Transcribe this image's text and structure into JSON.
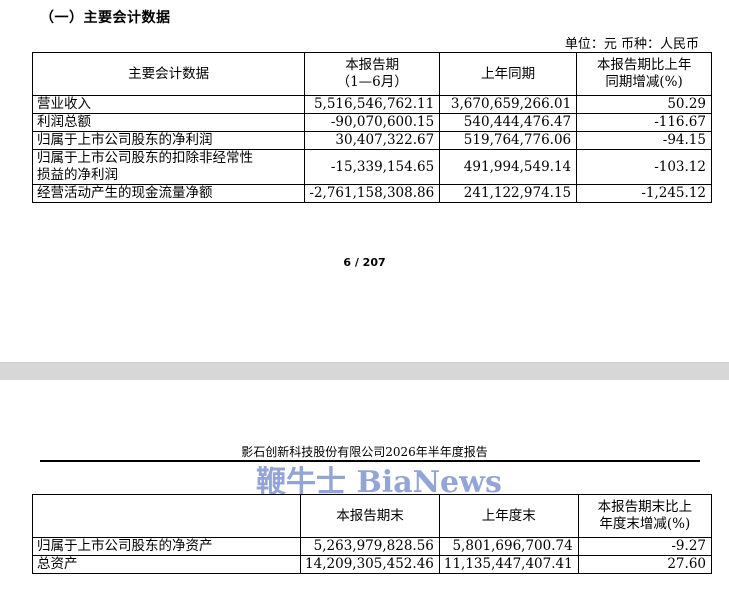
{
  "section_title": "（一）主要会计数据",
  "unit_line": "单位：元  币种：人民币",
  "table1": {
    "headers": [
      "主要会计数据",
      "本报告期",
      "（1—6月）",
      "上年同期",
      "本报告期比上年",
      "同期增减(%)"
    ],
    "rows": [
      {
        "label": "营业收入",
        "current": "5,516,546,762.11",
        "prior": "3,670,659,266.01",
        "change": "50.29"
      },
      {
        "label": "利润总额",
        "current": "-90,070,600.15",
        "prior": "540,444,476.47",
        "change": "-116.67"
      },
      {
        "label": "归属于上市公司股东的净利润",
        "current": "30,407,322.67",
        "prior": "519,764,776.06",
        "change": "-94.15"
      },
      {
        "label": "归属于上市公司股东的扣除非经常性",
        "label2": "损益的净利润",
        "current": "-15,339,154.65",
        "prior": "491,994,549.14",
        "change": "-103.12"
      },
      {
        "label": "经营活动产生的现金流量净额",
        "current": "-2,761,158,308.86",
        "prior": "241,122,974.15",
        "change": "-1,245.12"
      }
    ]
  },
  "page_number": "6 / 207",
  "running_header": "影石创新科技股份有限公司2026年半年度报告",
  "watermark": "鞭牛士 BiaNews",
  "table2": {
    "headers": [
      "",
      "本报告期末",
      "上年度末",
      "本报告期末比上",
      "年度末增减(%)"
    ],
    "rows": [
      {
        "label": "归属于上市公司股东的净资产",
        "current": "5,263,979,828.56",
        "prior": "5,801,696,700.74",
        "change": "-9.27"
      },
      {
        "label": "总资产",
        "current": "14,209,305,452.46",
        "prior": "11,135,447,407.41",
        "change": "27.60"
      }
    ]
  }
}
